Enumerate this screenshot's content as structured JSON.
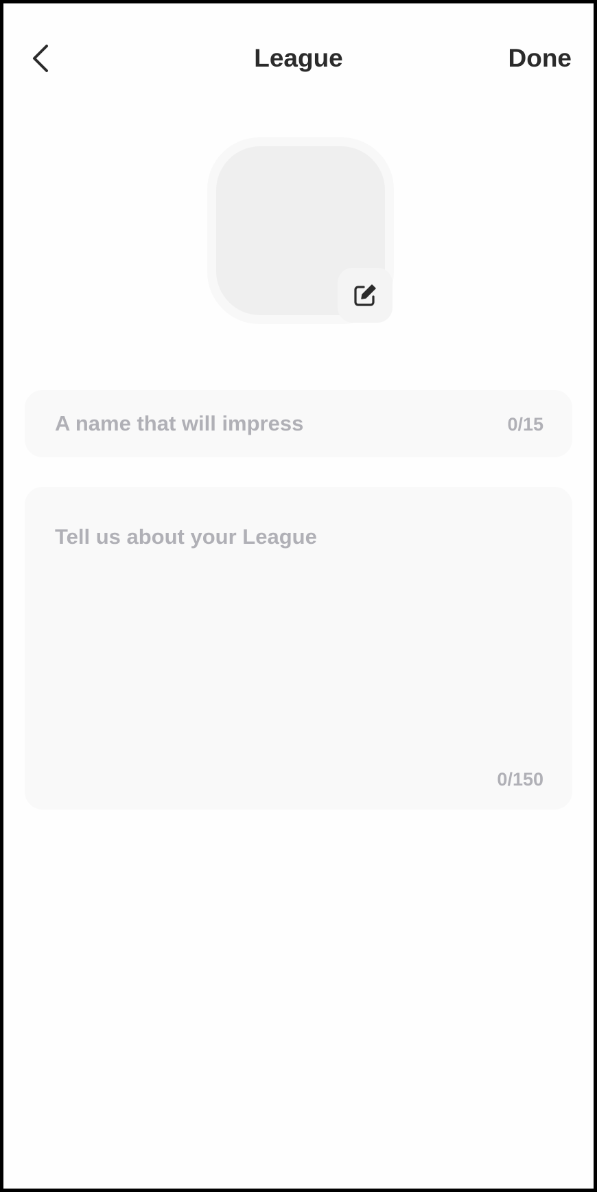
{
  "header": {
    "title": "League",
    "done_label": "Done",
    "back_icon": "chevron-left-icon"
  },
  "avatar": {
    "edit_icon": "edit-square-icon"
  },
  "name_field": {
    "placeholder": "A name that will impress",
    "value": "",
    "counter": "0/15"
  },
  "description_field": {
    "placeholder": "Tell us about your League",
    "value": "",
    "counter": "0/150"
  },
  "colors": {
    "text_primary": "#2b2b2b",
    "placeholder": "#b0b0b6",
    "field_background": "#f9f9f9",
    "avatar_background": "#efefef"
  }
}
